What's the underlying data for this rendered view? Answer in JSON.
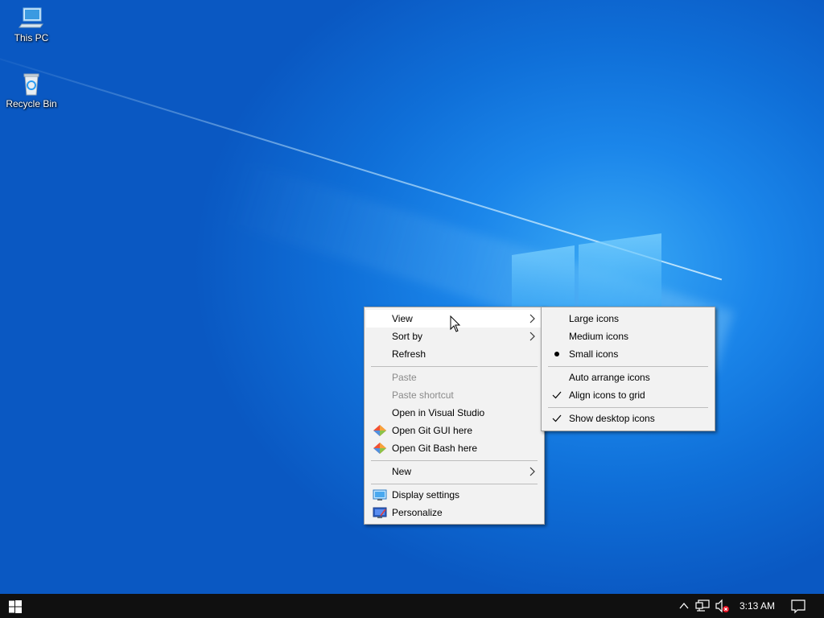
{
  "desktop": {
    "icons": [
      {
        "label": "This PC",
        "icon": "this-pc-icon"
      },
      {
        "label": "Recycle Bin",
        "icon": "recycle-bin-icon"
      }
    ]
  },
  "context_menu": {
    "items": [
      {
        "label": "View",
        "submenu": true
      },
      {
        "label": "Sort by",
        "submenu": true
      },
      {
        "label": "Refresh"
      },
      {
        "label": "Paste",
        "disabled": true
      },
      {
        "label": "Paste shortcut",
        "disabled": true
      },
      {
        "label": "Open in Visual Studio"
      },
      {
        "label": "Open Git GUI here",
        "icon": "git-gui-icon"
      },
      {
        "label": "Open Git Bash here",
        "icon": "git-bash-icon"
      },
      {
        "label": "New",
        "submenu": true
      },
      {
        "label": "Display settings",
        "icon": "display-settings-icon"
      },
      {
        "label": "Personalize",
        "icon": "personalize-icon"
      }
    ]
  },
  "view_submenu": {
    "items": [
      {
        "label": "Large icons"
      },
      {
        "label": "Medium icons"
      },
      {
        "label": "Small icons",
        "selected": true
      },
      {
        "label": "Auto arrange icons",
        "checked": false
      },
      {
        "label": "Align icons to grid",
        "checked": true
      },
      {
        "label": "Show desktop icons",
        "checked": true
      }
    ]
  },
  "taskbar": {
    "clock": "3:13 AM",
    "tray_icons": [
      "chevron-up-icon",
      "network-icon",
      "volume-muted-icon",
      "notification-icon"
    ]
  },
  "colors": {
    "menu_bg": "#f2f2f2",
    "menu_hover": "#ffffff",
    "taskbar": "#101010",
    "desktop_accent": "#0f6fd8"
  }
}
